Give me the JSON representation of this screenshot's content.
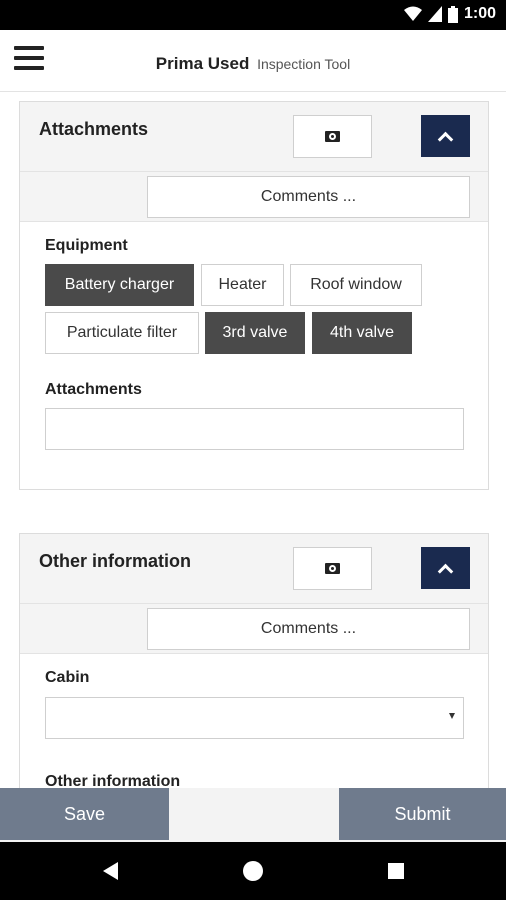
{
  "status_bar": {
    "time": "1:00",
    "icons": [
      "wifi-icon",
      "signal-icon",
      "battery-icon"
    ]
  },
  "app_bar": {
    "brand": "Prima Used",
    "subtitle": "Inspection Tool"
  },
  "attachments_panel": {
    "title": "Attachments",
    "comments_label": "Comments ...",
    "equipment_label": "Equipment",
    "chips": [
      {
        "label": "Battery charger",
        "selected": true
      },
      {
        "label": "Heater",
        "selected": false
      },
      {
        "label": "Roof window",
        "selected": false
      },
      {
        "label": "Particulate filter",
        "selected": false
      },
      {
        "label": "3rd valve",
        "selected": true
      },
      {
        "label": "4th valve",
        "selected": true
      }
    ],
    "attachments_field_label": "Attachments",
    "attachments_field_value": ""
  },
  "other_panel": {
    "title": "Other information",
    "comments_label": "Comments ...",
    "cabin_label": "Cabin",
    "cabin_value": "",
    "other_info_label": "Other information"
  },
  "actions": {
    "save": "Save",
    "submit": "Submit"
  },
  "colors": {
    "header_button": "#1a2a4f",
    "chip_selected": "#4a4a4a",
    "action_button": "#6f7b8d"
  }
}
